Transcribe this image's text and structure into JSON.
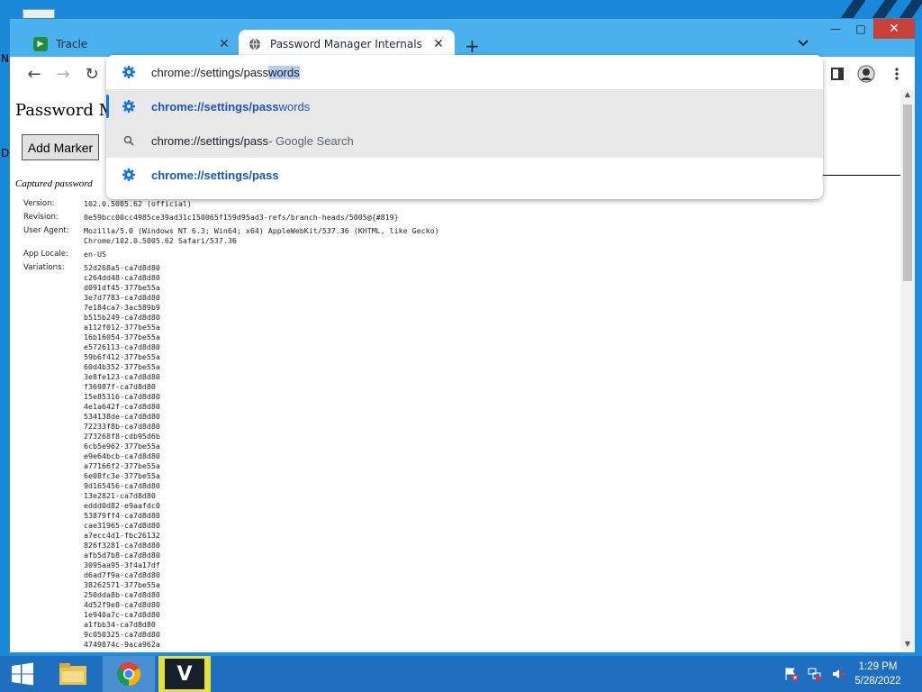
{
  "desktop": {
    "glyph_top": "N",
    "glyph_mid": "D"
  },
  "window": {
    "minimize_label": "—",
    "maximize_label": "□",
    "close_label": "✕"
  },
  "tabs": [
    {
      "title": "Tracle",
      "icon": "trace-favicon",
      "active": false
    },
    {
      "title": "Password Manager Internals",
      "icon": "globe-icon",
      "active": true
    }
  ],
  "tabstrip": {
    "new_tab": "+",
    "tab_search": "⌄"
  },
  "toolbar": {
    "back": "←",
    "forward": "→",
    "reload": "↻"
  },
  "omnibox": {
    "typed_prefix": "chrome://settings/pass",
    "autocomplete_suffix": "words",
    "suggestions": [
      {
        "bold": "chrome://settings/pass",
        "rest": "words",
        "icon": "gear-icon"
      },
      {
        "text": "chrome://settings/pass",
        "desc": " - Google Search",
        "icon": "search-icon"
      },
      {
        "bold": "chrome://settings/pass",
        "rest": "",
        "icon": "gear-icon"
      }
    ]
  },
  "page": {
    "title": "Password Ma",
    "add_marker": "Add Marker",
    "captured": "Captured password",
    "info": {
      "version_label": "Version:",
      "version": "102.0.5005.62 (official)",
      "revision_label": "Revision:",
      "revision": "0e59bcc00cc4985ce39ad31c150065f159d95ad3-refs/branch-heads/5005@{#819}",
      "user_agent_label": "User Agent:",
      "user_agent_1": "Mozilla/5.0 (Windows NT 6.3; Win64; x64) AppleWebKit/537.36 (KHTML, like Gecko)",
      "user_agent_2": "Chrome/102.0.5005.62 Safari/537.36",
      "locale_label": "App Locale:",
      "locale": "en-US",
      "variations_label": "Variations:",
      "variations": [
        "52d268a5-ca7d8d80",
        "c264dd48-ca7d8d80",
        "d091df45-377be55a",
        "3e7d7783-ca7d8d80",
        "7e184ca7-3ac589b9",
        "b515b249-ca7d8d80",
        "a112f012-377be55a",
        "16b16054-377be55a",
        "e5726113-ca7d8d80",
        "59b6f412-377be55a",
        "60d4b352-377be55a",
        "3e8fe123-ca7d8d80",
        "f36987f-ca7d8d80",
        "15e85316-ca7d8d80",
        "4e1a642f-ca7d8d80",
        "534138de-ca7d8d80",
        "72233f8b-ca7d8d80",
        "273268f8-cdb95d6b",
        "6cb5e962-377be55a",
        "e9e64bcb-ca7d8d80",
        "a77166f2-377be55a",
        "6e08fc3e-377be55a",
        "9d165456-ca7d8d80",
        "13e2821-ca7d8d80",
        "eddd0d82-e9aafdc0",
        "53879ff4-ca7d8d80",
        "cae31965-ca7d8d80",
        "a7ecc4d1-fbc26132",
        "826f3281-ca7d8d80",
        "afb5d7b8-ca7d8d80",
        "3095aa95-3f4a17df",
        "d6ad7f9a-ca7d8d80",
        "38262571-377be55a",
        "250dda8b-ca7d8d80",
        "4d52f9e8-ca7d8d80",
        "1e940a7c-ca7d8d80",
        "a1fbb34-ca7d8d80",
        "9c050325-ca7d8d80",
        "4749874c-9aca962a"
      ]
    }
  },
  "taskbar": {
    "time": "1:29 PM",
    "date": "5/28/2022",
    "v_app_label": "V"
  },
  "colors": {
    "accent": "#1a73e8",
    "taskbar": "#1f6fc0",
    "close_button": "#c7403a"
  }
}
